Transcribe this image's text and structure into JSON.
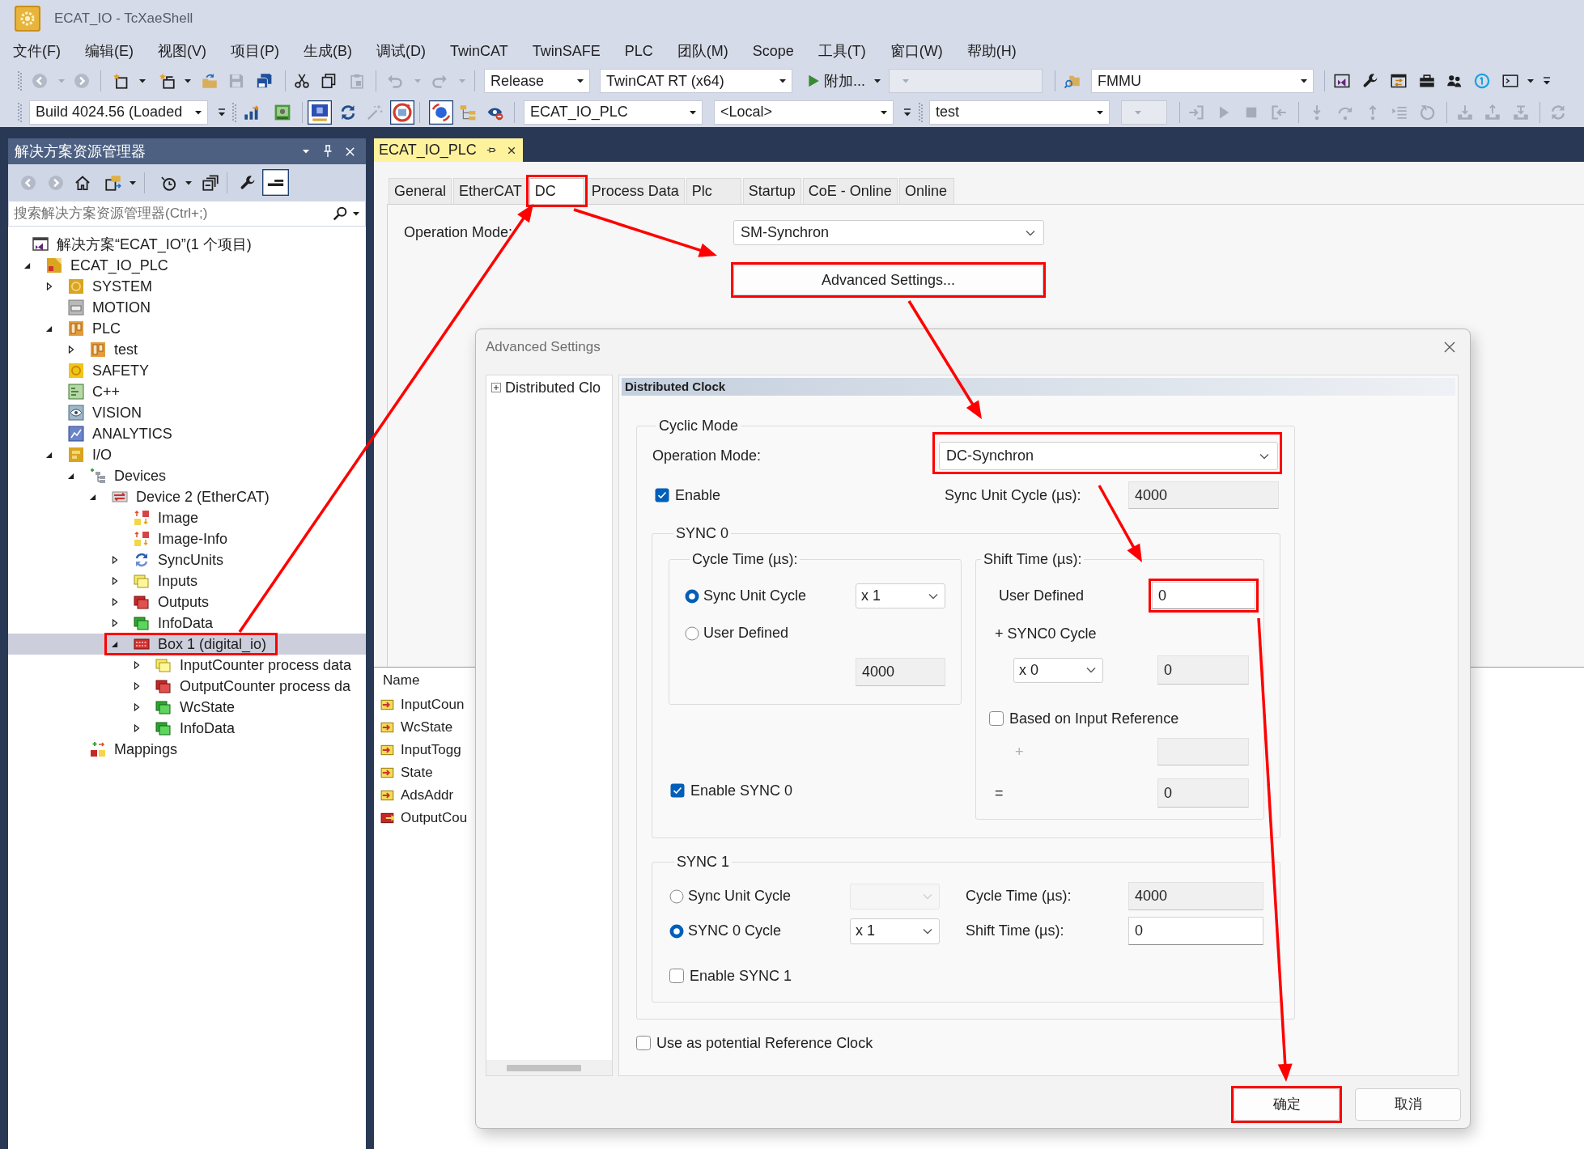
{
  "window": {
    "title": "ECAT_IO - TcXaeShell"
  },
  "menu": [
    "文件(F)",
    "编辑(E)",
    "视图(V)",
    "项目(P)",
    "生成(B)",
    "调试(D)",
    "TwinCAT",
    "TwinSAFE",
    "PLC",
    "团队(M)",
    "Scope",
    "工具(T)",
    "窗口(W)",
    "帮助(H)"
  ],
  "toolbar_1": {
    "configuration_dropdown": "Release",
    "platform_dropdown": "TwinCAT RT (x64)",
    "attach_button": "附加...",
    "search_dropdown": "FMMU"
  },
  "toolbar_2": {
    "build_dropdown": "Build 4024.56 (Loaded",
    "project_dropdown": "ECAT_IO_PLC",
    "target_dropdown": "<Local>",
    "plc_project_dropdown": "test"
  },
  "solution_explorer": {
    "title": "解决方案资源管理器",
    "search": {
      "placeholder": "搜索解决方案资源管理器(Ctrl+;)"
    },
    "tree": [
      {
        "label": "解决方案“ECAT_IO”(1 个项目)",
        "kind": "solution",
        "selected": false,
        "highlighted": false,
        "children": [
          {
            "label": "ECAT_IO_PLC",
            "kind": "project",
            "expanded": true,
            "selected": false,
            "highlighted": false,
            "children": [
              {
                "label": "SYSTEM",
                "kind": "system",
                "expanded": false,
                "selected": false,
                "highlighted": false
              },
              {
                "label": "MOTION",
                "kind": "motion",
                "selected": false,
                "highlighted": false
              },
              {
                "label": "PLC",
                "kind": "plc",
                "expanded": true,
                "selected": false,
                "highlighted": false,
                "children": [
                  {
                    "label": "test",
                    "kind": "plc",
                    "expanded": false,
                    "selected": false,
                    "highlighted": false
                  }
                ]
              },
              {
                "label": "SAFETY",
                "kind": "safety",
                "selected": false,
                "highlighted": false
              },
              {
                "label": "C++",
                "kind": "cpp",
                "selected": false,
                "highlighted": false
              },
              {
                "label": "VISION",
                "kind": "vision",
                "selected": false,
                "highlighted": false
              },
              {
                "label": "ANALYTICS",
                "kind": "analytics",
                "selected": false,
                "highlighted": false
              },
              {
                "label": "I/O",
                "kind": "io",
                "expanded": true,
                "selected": false,
                "highlighted": false,
                "children": [
                  {
                    "label": "Devices",
                    "kind": "devices",
                    "expanded": true,
                    "selected": false,
                    "highlighted": false,
                    "children": [
                      {
                        "label": "Device 2 (EtherCAT)",
                        "kind": "device",
                        "expanded": true,
                        "selected": false,
                        "highlighted": false,
                        "children": [
                          {
                            "label": "Image",
                            "kind": "image",
                            "selected": false,
                            "highlighted": false
                          },
                          {
                            "label": "Image-Info",
                            "kind": "image",
                            "selected": false,
                            "highlighted": false
                          },
                          {
                            "label": "SyncUnits",
                            "kind": "syncunits",
                            "expanded": false,
                            "selected": false,
                            "highlighted": false
                          },
                          {
                            "label": "Inputs",
                            "kind": "inputs",
                            "expanded": false,
                            "selected": false,
                            "highlighted": false
                          },
                          {
                            "label": "Outputs",
                            "kind": "outputs",
                            "expanded": false,
                            "selected": false,
                            "highlighted": false
                          },
                          {
                            "label": "InfoData",
                            "kind": "infodata",
                            "expanded": false,
                            "selected": false,
                            "highlighted": false
                          },
                          {
                            "label": "Box 1 (digital_io)",
                            "kind": "box",
                            "expanded": true,
                            "selected": true,
                            "highlighted": true,
                            "children": [
                              {
                                "label": "InputCounter process data",
                                "kind": "inputs",
                                "expanded": false,
                                "selected": false,
                                "highlighted": false
                              },
                              {
                                "label": "OutputCounter process da",
                                "kind": "outputs",
                                "expanded": false,
                                "selected": false,
                                "highlighted": false
                              },
                              {
                                "label": "WcState",
                                "kind": "infodata",
                                "expanded": false,
                                "selected": false,
                                "highlighted": false
                              },
                              {
                                "label": "InfoData",
                                "kind": "infodata",
                                "expanded": false,
                                "selected": false,
                                "highlighted": false
                              }
                            ]
                          }
                        ]
                      }
                    ]
                  },
                  {
                    "label": "Mappings",
                    "kind": "mappings",
                    "selected": false,
                    "highlighted": false
                  }
                ]
              }
            ]
          }
        ]
      }
    ]
  },
  "editor": {
    "document_tab": "ECAT_IO_PLC",
    "tabs": [
      {
        "label": "General",
        "selected": false,
        "highlighted": false
      },
      {
        "label": "EtherCAT",
        "selected": false,
        "highlighted": false
      },
      {
        "label": "DC",
        "selected": true,
        "highlighted": true
      },
      {
        "label": "Process Data",
        "selected": false,
        "highlighted": false
      },
      {
        "label": "Plc",
        "selected": false,
        "highlighted": false
      },
      {
        "label": "Startup",
        "selected": false,
        "highlighted": false
      },
      {
        "label": "CoE - Online",
        "selected": false,
        "highlighted": false
      },
      {
        "label": "Online",
        "selected": false,
        "highlighted": false
      }
    ],
    "operation_mode": {
      "label": "Operation Mode:",
      "value": "SM-Synchron"
    },
    "advanced_button": {
      "label": "Advanced Settings...",
      "highlighted": true
    },
    "variables": {
      "columns": [
        "Name"
      ],
      "rows": [
        {
          "name": "InputCoun",
          "kind": "input"
        },
        {
          "name": "WcState",
          "kind": "input"
        },
        {
          "name": "InputTogg",
          "kind": "input"
        },
        {
          "name": "State",
          "kind": "input"
        },
        {
          "name": "AdsAddr",
          "kind": "input"
        },
        {
          "name": "OutputCou",
          "kind": "output"
        }
      ]
    }
  },
  "dialog": {
    "title": "Advanced Settings",
    "tree": [
      {
        "label": "Distributed Clo",
        "expanded": false
      }
    ],
    "section_title": "Distributed Clock",
    "cyclic_mode": {
      "title": "Cyclic Mode",
      "operation_mode": {
        "label": "Operation Mode:",
        "value": "DC-Synchron",
        "highlighted": true
      },
      "enable": {
        "label": "Enable",
        "checked": true
      },
      "sync_unit_cycle": {
        "label": "Sync Unit Cycle (µs):",
        "value": "4000",
        "disabled": true
      },
      "sync0": {
        "title": "SYNC 0",
        "cycle_time": {
          "title": "Cycle Time (µs):",
          "options": [
            {
              "label": "Sync Unit Cycle",
              "selected": true,
              "multiplier": {
                "value": "x 1",
                "disabled": false
              }
            },
            {
              "label": "User Defined",
              "selected": false
            }
          ],
          "user_value": {
            "value": "4000",
            "disabled": true
          }
        },
        "shift_time": {
          "title": "Shift Time (µs):",
          "user_defined": {
            "label": "User Defined",
            "value": "0",
            "disabled": false,
            "highlighted": true
          },
          "sync0_cycle": {
            "label": "+ SYNC0 Cycle",
            "multiplier": {
              "value": "x 0",
              "disabled": false
            },
            "value_field": {
              "value": "0",
              "disabled": true
            }
          },
          "input_reference": {
            "label": "Based on Input Reference",
            "checked": false
          },
          "plus": {
            "label": "+",
            "disabled": true
          },
          "total": {
            "label": "=",
            "value": "0",
            "disabled": true
          }
        },
        "enable": {
          "label": "Enable SYNC 0",
          "checked": true
        }
      },
      "sync1": {
        "title": "SYNC 1",
        "rows": [
          {
            "option": {
              "label": "Sync Unit Cycle",
              "selected": false
            },
            "multiplier": {
              "disabled": true
            },
            "time": {
              "label": "Cycle Time (µs):",
              "value": "4000",
              "disabled": true
            }
          },
          {
            "option": {
              "label": "SYNC 0 Cycle",
              "selected": true
            },
            "multiplier": {
              "value": "x 1",
              "disabled": false
            },
            "time": {
              "label": "Shift Time (µs):",
              "value": "0",
              "disabled": false
            }
          }
        ],
        "enable": {
          "label": "Enable SYNC 1",
          "checked": false
        }
      }
    },
    "reference_clock": {
      "label": "Use as potential Reference Clock",
      "checked": false
    },
    "buttons": [
      {
        "label": "确定",
        "highlighted": true
      },
      {
        "label": "取消",
        "highlighted": false
      }
    ]
  }
}
